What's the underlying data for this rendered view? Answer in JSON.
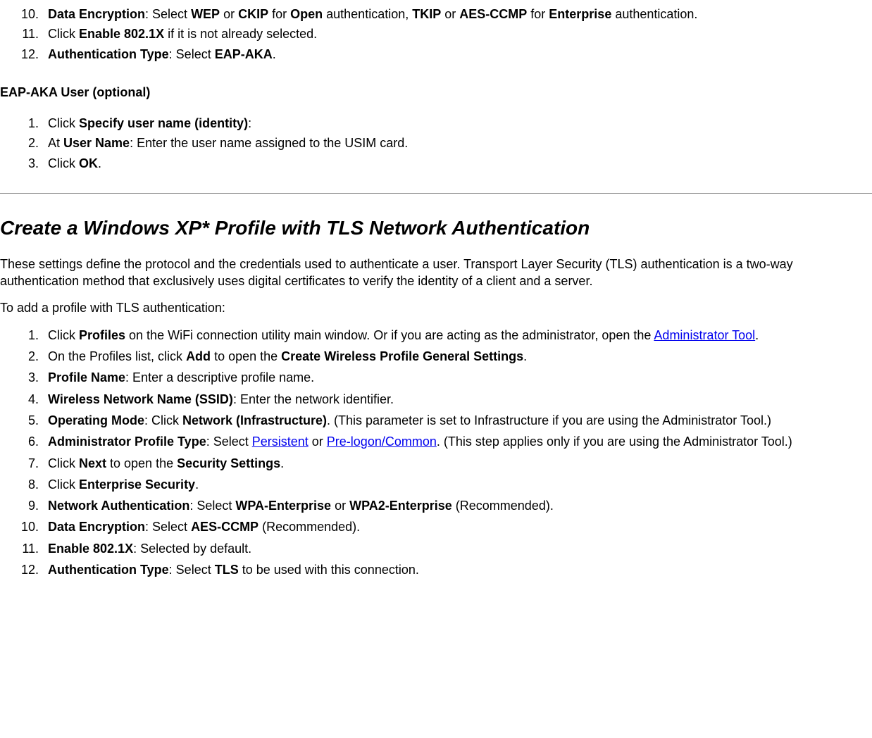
{
  "topList": {
    "item10": {
      "bold1": "Data Encryption",
      "text1": ": Select ",
      "bold2": "WEP",
      "text2": " or ",
      "bold3": "CKIP",
      "text3": " for ",
      "bold4": "Open",
      "text4": " authentication, ",
      "bold5": "TKIP",
      "text5": " or ",
      "bold6": "AES-CCMP",
      "text6": " for ",
      "bold7": "Enterprise",
      "text7": " authentication."
    },
    "item11": {
      "text1": "Click ",
      "bold1": "Enable 802.1X",
      "text2": " if it is not already selected."
    },
    "item12": {
      "bold1": "Authentication Type",
      "text1": ": Select ",
      "bold2": "EAP-AKA",
      "text2": "."
    }
  },
  "eapAkaHeading": "EAP-AKA User (optional)",
  "eapAkaList": {
    "item1": {
      "text1": "Click ",
      "bold1": "Specify user name (identity)",
      "text2": ":"
    },
    "item2": {
      "text1": "At ",
      "bold1": "User Name",
      "text2": ": Enter the user name assigned to the USIM card."
    },
    "item3": {
      "text1": "Click ",
      "bold1": "OK",
      "text2": "."
    }
  },
  "tlsHeading": "Create a Windows XP* Profile with TLS Network Authentication",
  "tlsPara1": "These settings define the protocol and the credentials used to authenticate a user. Transport Layer Security (TLS) authentication is a two-way authentication method that exclusively uses digital certificates to verify the identity of a client and a server.",
  "tlsPara2": "To add a profile with TLS authentication:",
  "tlsList": {
    "item1": {
      "text1": "Click ",
      "bold1": "Profiles",
      "text2": " on the WiFi connection utility main window. Or if you are acting as the administrator, open the ",
      "link1": "Administrator Tool",
      "text3": "."
    },
    "item2": {
      "text1": "On the Profiles list, click ",
      "bold1": "Add",
      "text2": " to open the ",
      "bold2": "Create Wireless Profile General Settings",
      "text3": "."
    },
    "item3": {
      "bold1": "Profile Name",
      "text1": ": Enter a descriptive profile name."
    },
    "item4": {
      "bold1": "Wireless Network Name (SSID)",
      "text1": ": Enter the network identifier."
    },
    "item5": {
      "bold1": "Operating Mode",
      "text1": ": Click ",
      "bold2": "Network (Infrastructure)",
      "text2": ". (This parameter is set to Infrastructure if you are using the Administrator Tool.)"
    },
    "item6": {
      "bold1": "Administrator Profile Type",
      "text1": ": Select ",
      "link1": "Persistent",
      "text2": " or ",
      "link2": "Pre-logon/Common",
      "text3": ". (This step applies only if you are using the Administrator Tool.)"
    },
    "item7": {
      "text1": "Click ",
      "bold1": "Next",
      "text2": " to open the ",
      "bold2": "Security Settings",
      "text3": "."
    },
    "item8": {
      "text1": "Click ",
      "bold1": "Enterprise Security",
      "text2": "."
    },
    "item9": {
      "bold1": "Network Authentication",
      "text1": ": Select ",
      "bold2": "WPA-Enterprise",
      "text2": " or ",
      "bold3": "WPA2-Enterprise",
      "text3": " (Recommended)."
    },
    "item10": {
      "bold1": "Data Encryption",
      "text1": ": Select ",
      "bold2": "AES-CCMP",
      "text2": " (Recommended)."
    },
    "item11": {
      "bold1": "Enable 802.1X",
      "text1": ": Selected by default."
    },
    "item12": {
      "bold1": "Authentication Type",
      "text1": ": Select ",
      "bold2": "TLS",
      "text2": " to be used with this connection."
    }
  }
}
